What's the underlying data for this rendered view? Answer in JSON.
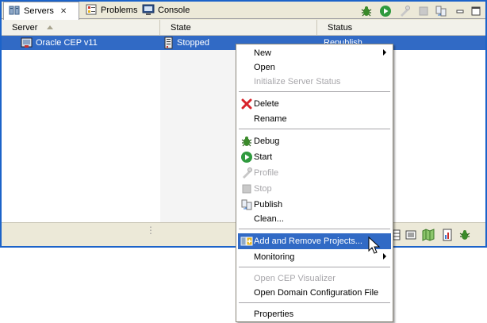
{
  "tabs": [
    {
      "label": "Servers",
      "icon": "servers-icon",
      "active": true
    },
    {
      "label": "Problems",
      "icon": "problems-icon",
      "active": false
    },
    {
      "label": "Console",
      "icon": "console-icon",
      "active": false
    }
  ],
  "toolbar": {
    "icons": [
      "debug-icon",
      "start-icon",
      "profile-icon",
      "stop-icon",
      "publish-icon",
      "minimize-icon",
      "maximize-icon"
    ]
  },
  "table": {
    "columns": [
      "Server",
      "State",
      "Status"
    ],
    "rows": [
      {
        "server": "Oracle CEP v11",
        "state": "Stopped",
        "status": "Republish"
      }
    ]
  },
  "context_menu": {
    "items": [
      {
        "label": "New",
        "has_submenu": true,
        "enabled": true
      },
      {
        "label": "Open",
        "enabled": true
      },
      {
        "label": "Initialize Server Status",
        "enabled": false
      },
      {
        "label": "Delete",
        "icon": "delete-icon",
        "enabled": true
      },
      {
        "label": "Rename",
        "enabled": true
      },
      {
        "label": "Debug",
        "icon": "debug-icon",
        "enabled": true
      },
      {
        "label": "Start",
        "icon": "start-icon",
        "enabled": true
      },
      {
        "label": "Profile",
        "icon": "profile-icon",
        "enabled": false
      },
      {
        "label": "Stop",
        "icon": "stop-icon",
        "enabled": false
      },
      {
        "label": "Publish",
        "icon": "publish-icon",
        "enabled": true
      },
      {
        "label": "Clean...",
        "enabled": true
      },
      {
        "label": "Add and Remove Projects...",
        "enabled": true,
        "highlighted": true
      },
      {
        "label": "Monitoring",
        "has_submenu": true,
        "enabled": true
      },
      {
        "label": "Open CEP Visualizer",
        "enabled": false
      },
      {
        "label": "Open Domain Configuration File",
        "enabled": true
      },
      {
        "label": "Properties",
        "enabled": true
      }
    ]
  },
  "colors": {
    "selection": "#316ac5",
    "frame": "#1c63c9",
    "chrome": "#ece9d8",
    "disabled_text": "#a7a6aa"
  }
}
